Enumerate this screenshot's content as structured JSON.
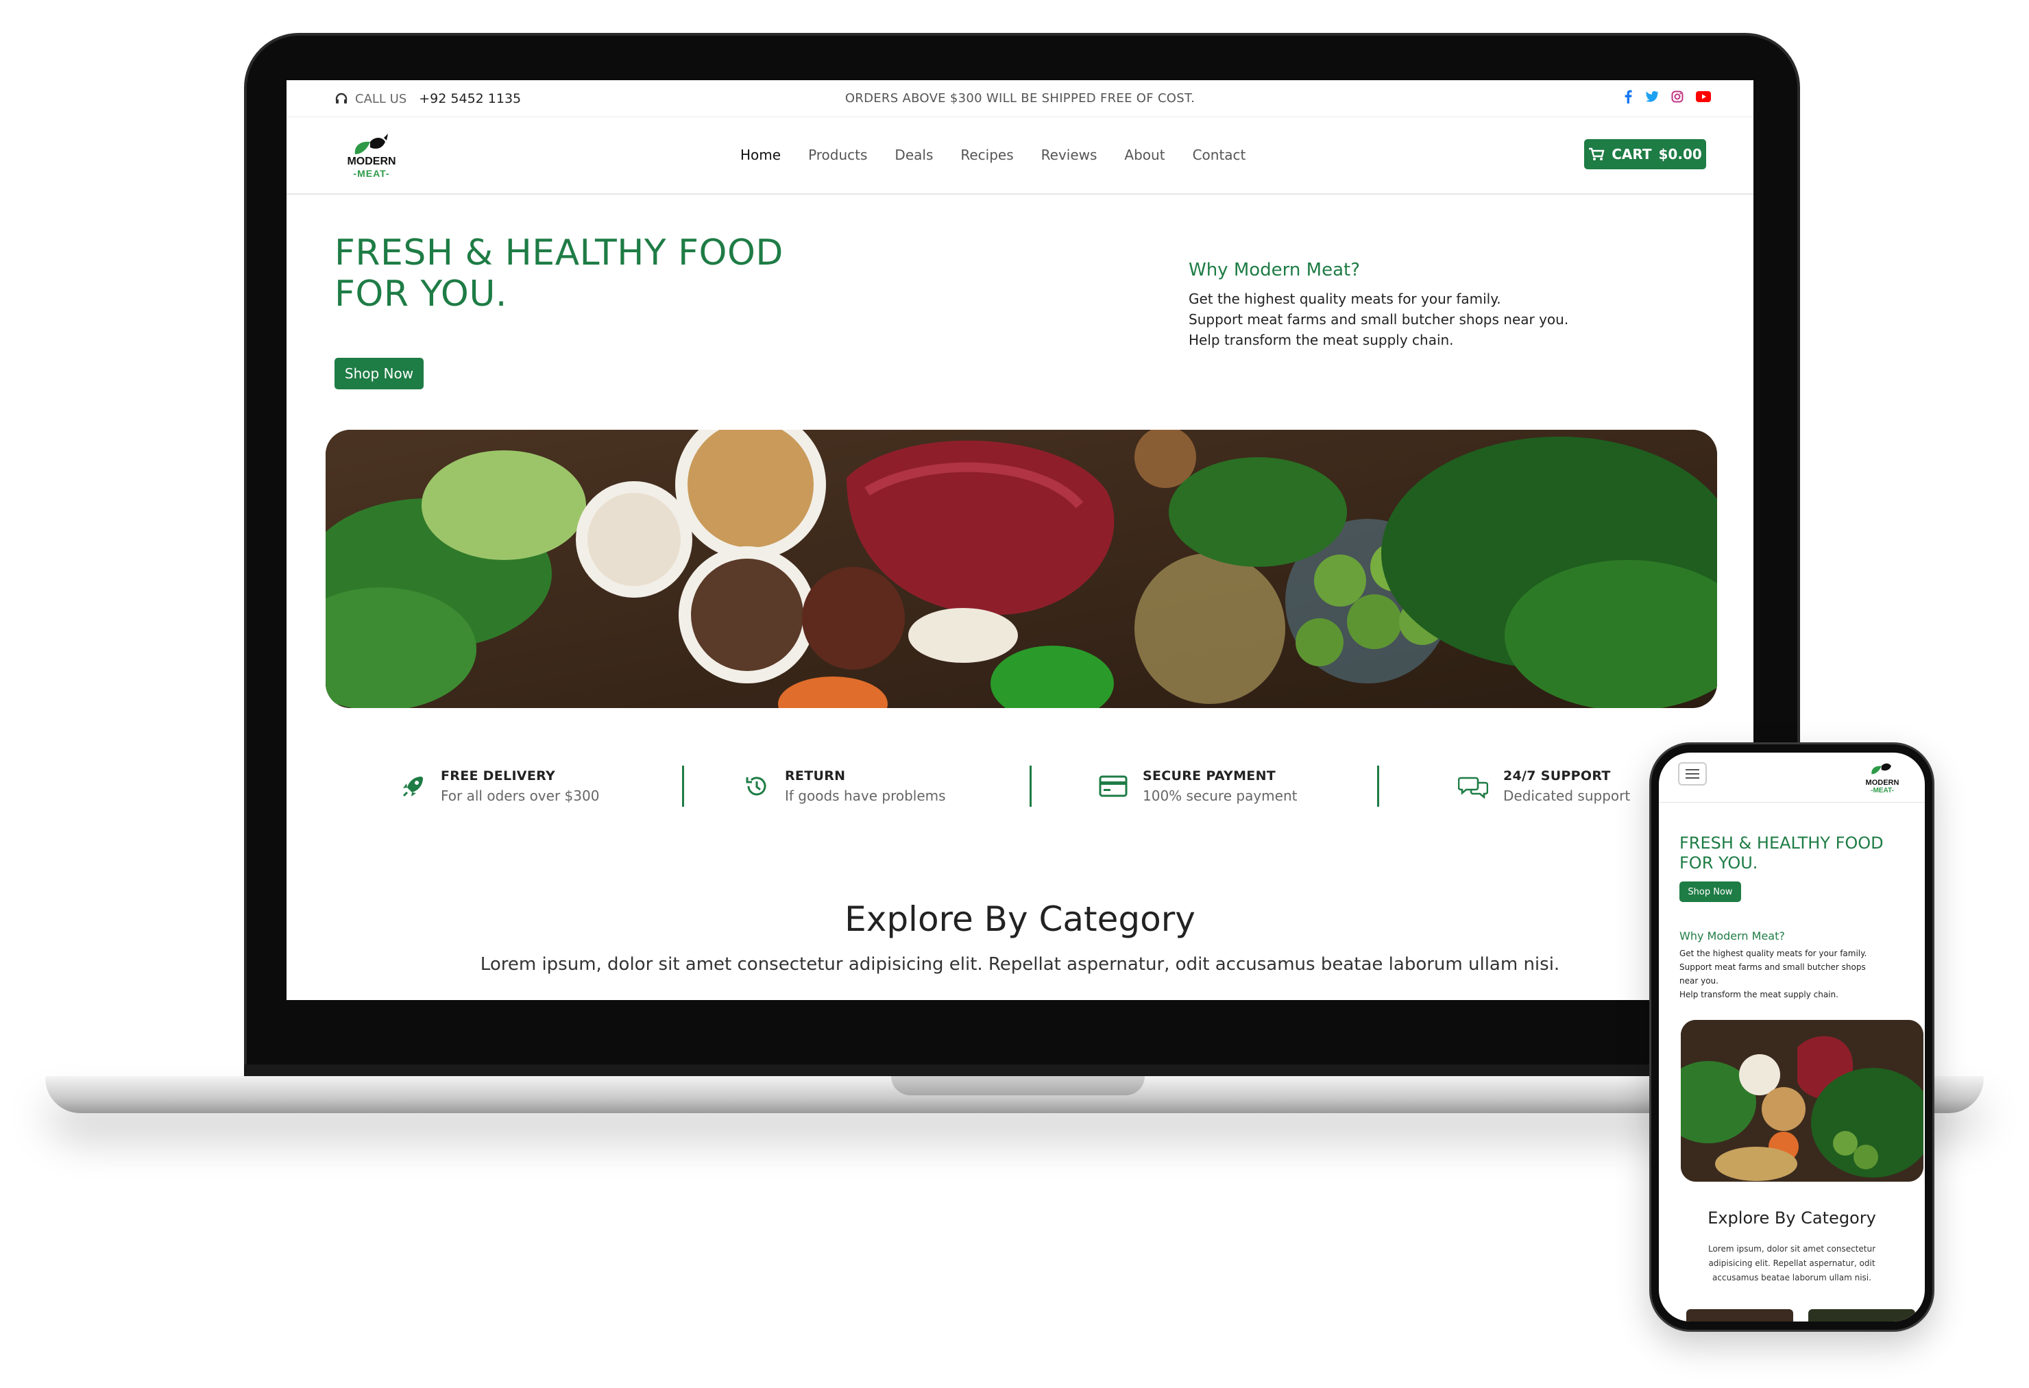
{
  "topbar": {
    "call_label": "CALL US",
    "phone": "+92 5452 1135",
    "notice": "ORDERS ABOVE $300 WILL BE SHIPPED FREE OF COST.",
    "social_icons": [
      "facebook-icon",
      "twitter-icon",
      "instagram-icon",
      "youtube-icon"
    ]
  },
  "brand": {
    "line1": "MODERN",
    "line2": "-MEAT-"
  },
  "nav": {
    "items": [
      "Home",
      "Products",
      "Deals",
      "Recipes",
      "Reviews",
      "About",
      "Contact"
    ],
    "active": "Home"
  },
  "cart": {
    "label": "CART",
    "amount": "$0.00"
  },
  "hero": {
    "title_line1": "FRESH & HEALTHY FOOD",
    "title_line2": "FOR YOU.",
    "cta": "Shop Now",
    "why_title": "Why Modern Meat?",
    "why_lines": [
      "Get the highest quality meats for your family.",
      "Support meat farms and small butcher shops near you.",
      "Help transform the meat supply chain."
    ]
  },
  "features": [
    {
      "title": "FREE DELIVERY",
      "subtitle": "For all oders over $300",
      "icon": "rocket-icon"
    },
    {
      "title": "RETURN",
      "subtitle": "If goods have problems",
      "icon": "history-icon"
    },
    {
      "title": "SECURE PAYMENT",
      "subtitle": "100% secure payment",
      "icon": "credit-card-icon"
    },
    {
      "title": "24/7 SUPPORT",
      "subtitle": "Dedicated support",
      "icon": "chat-icon"
    }
  ],
  "explore": {
    "title": "Explore By Category",
    "subtitle": "Lorem ipsum, dolor sit amet consectetur adipisicing elit. Repellat aspernatur, odit accusamus beatae laborum ullam nisi."
  },
  "mobile": {
    "title_line1": "FRESH & HEALTHY FOOD",
    "title_line2": "FOR YOU.",
    "cta": "Shop Now",
    "why_title": "Why Modern Meat?",
    "why_lines": [
      "Get the highest quality meats for your family.",
      "Support meat farms and small butcher shops",
      "near you.",
      "Help transform the meat supply chain."
    ],
    "explore_title": "Explore By Category",
    "explore_lines": [
      "Lorem ipsum, dolor sit amet consectetur",
      "adipisicing elit. Repellat aspernatur, odit",
      "accusamus beatae laborum ullam nisi."
    ]
  },
  "colors": {
    "brand_green": "#1e7c45",
    "text_dark": "#222222",
    "muted": "#666666"
  }
}
